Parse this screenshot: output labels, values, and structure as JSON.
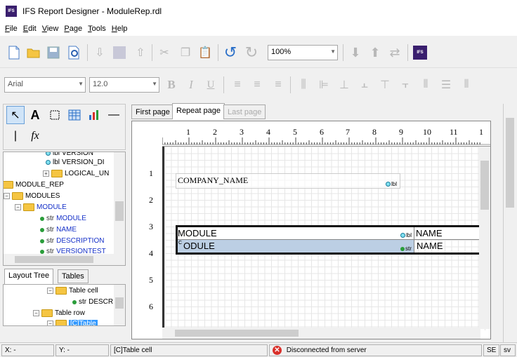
{
  "window": {
    "title": "IFS Report Designer - ModuleRep.rdl",
    "logo_text": "IFS"
  },
  "menu": [
    {
      "key": "F",
      "rest": "ile"
    },
    {
      "key": "E",
      "rest": "dit"
    },
    {
      "key": "V",
      "rest": "iew"
    },
    {
      "key": "P",
      "rest": "age"
    },
    {
      "key": "T",
      "rest": "ools"
    },
    {
      "key": "H",
      "rest": "elp"
    }
  ],
  "toolbar": {
    "zoom": "100%",
    "font_name": "Arial",
    "font_size": "12.0",
    "bold": "B",
    "italic": "I",
    "underline": "U",
    "ifs_text": "IFS"
  },
  "tools": {
    "text_tool": "A",
    "fx": "fx"
  },
  "tree": {
    "items": [
      {
        "label": "VERSION",
        "type": "lbl"
      },
      {
        "label": "VERSION_DI",
        "type": "lbl"
      },
      {
        "label": "LOGICAL_UN",
        "type": "folder"
      },
      {
        "label": "MODULE_REP",
        "type": "folder"
      },
      {
        "label": "MODULES",
        "type": "folder"
      },
      {
        "label": "MODULE",
        "type": "folder"
      },
      {
        "label": "MODULE",
        "type": "str"
      },
      {
        "label": "NAME",
        "type": "str"
      },
      {
        "label": "DESCRIPTION",
        "type": "str"
      },
      {
        "label": "VERSIONTEST",
        "type": "str"
      }
    ],
    "icon_lbl": "lbl",
    "icon_str": "str"
  },
  "layout_tabs": [
    "Layout Tree",
    "Tables"
  ],
  "layout_tree": {
    "items": [
      "Table cell",
      "DESCR",
      "Table row",
      "[C]Table"
    ]
  },
  "page_tabs": [
    "First page",
    "Repeat page",
    "Last page"
  ],
  "ruler": {
    "top": [
      "1",
      "2",
      "3",
      "4",
      "5",
      "6",
      "7",
      "8",
      "9",
      "10",
      "11",
      "1"
    ],
    "left": [
      "1",
      "2",
      "3",
      "4",
      "5",
      "6"
    ]
  },
  "report": {
    "company_name": "COMPANY_NAME",
    "module": "MODULE",
    "name": "NAME",
    "module_row2": "ODULE",
    "module_row2_prefix": "C",
    "name_row2": "NAME",
    "lbl": "lbl",
    "str": "str"
  },
  "status": {
    "x": "X: -",
    "y": "Y: -",
    "selection": "[C]Table cell",
    "server": "Disconnected from server",
    "se": "SE",
    "sv": "sv"
  }
}
